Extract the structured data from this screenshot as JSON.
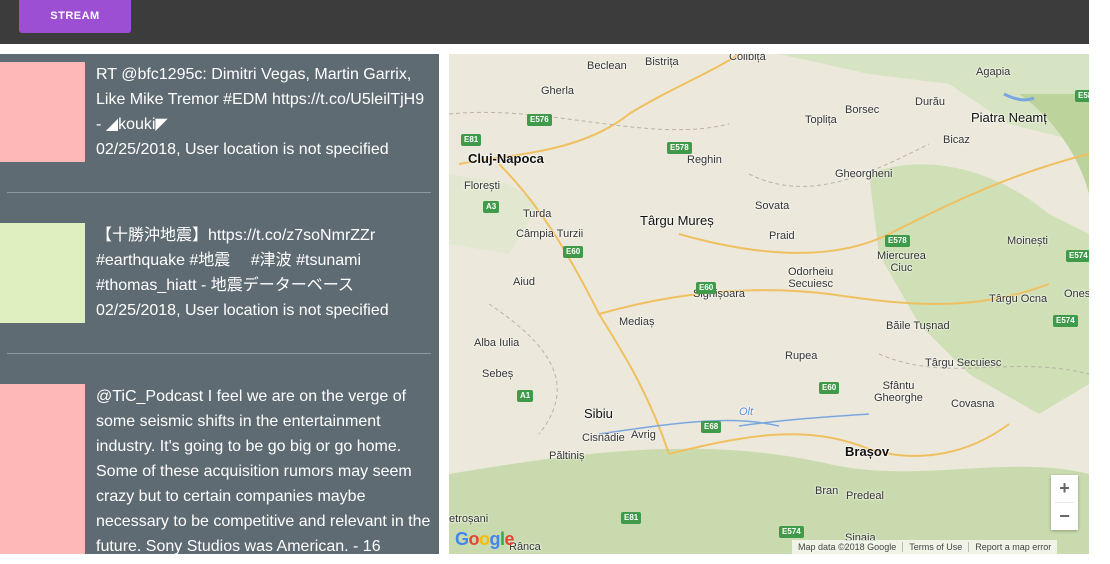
{
  "toolbar": {
    "stream_label": "STREAM"
  },
  "tweets": [
    {
      "color": "#ffb8b8",
      "text": "RT @bfc1295c: Dimitri Vegas, Martin Garrix, Like Mike Tremor #EDM https://t.co/U5leilTjH9 - ◢kouki◤",
      "meta": "02/25/2018, User location is not specified"
    },
    {
      "color": "#dff0c0",
      "text": "【十勝沖地震】https://t.co/z7soNmrZZr #earthquake #地震　 #津波 #tsunami #thomas_hiatt - 地震データーベース",
      "meta": "02/25/2018, User location is not specified"
    },
    {
      "color": "#ffb8b8",
      "text": "@TiC_Podcast I feel we are on the verge of some seismic shifts in the entertainment industry. It's going to be go big or go home. Some of these acquisition rumors may seem crazy but to certain companies maybe necessary to be competitive and relevant in the future. Sony Studios was American. - 16",
      "meta": ""
    }
  ],
  "map": {
    "cities": {
      "cluj": "Cluj-Napoca",
      "targu_mures": "Târgu Mureș",
      "brasov": "Brașov",
      "sibiu": "Sibiu",
      "alba_iulia": "Alba Iulia",
      "medias": "Mediaș",
      "sighisoara": "Sighișoara",
      "piatra_neamt": "Piatra Neamț",
      "beclean": "Beclean",
      "bistrita": "Bistrița",
      "gherla": "Gherla",
      "reghin": "Reghin",
      "toplita": "Toplița",
      "borsec": "Borsec",
      "bicaz": "Bicaz",
      "gheorgheni": "Gheorgheni",
      "floresti": "Florești",
      "turda": "Turda",
      "campia_turzii": "Câmpia Turzii",
      "sovata": "Sovata",
      "praid": "Praid",
      "miercurea_ciuc": "Miercurea\nCiuc",
      "moinesti": "Moinești",
      "aiud": "Aiud",
      "odorheiu": "Odorheiu\nSecuiesc",
      "targu_ocna": "Târgu Ocna",
      "onesti": "Ones",
      "baile_tusnad": "Băile Tușnad",
      "targu_secuiesc": "Târgu Secuiesc",
      "rupea": "Rupea",
      "sebes": "Sebeș",
      "sfantu": "Sfântu\nGheorghe",
      "covasna": "Covasna",
      "cisnadie": "Cisnădie",
      "avrig": "Avrig",
      "paltinis": "Păltiniș",
      "bran": "Bran",
      "predeal": "Predeal",
      "sinaia": "Sinaia",
      "petrosani": "etroșani",
      "ranca": "Rânca",
      "agapia": "Agapia",
      "duru": "Durău",
      "colibita": "Colibița",
      "olt": "Olt"
    },
    "roads": [
      "E81",
      "E576",
      "E578",
      "E60",
      "A3",
      "E60",
      "E60",
      "E578",
      "E574",
      "E574",
      "A1",
      "E68",
      "E60",
      "E81",
      "E574",
      "E58",
      "E81"
    ],
    "attribution": {
      "data": "Map data ©2018 Google",
      "terms": "Terms of Use",
      "report": "Report a map error"
    },
    "zoom_in": "+",
    "zoom_out": "−",
    "logo": {
      "g1": "G",
      "g2": "o",
      "g3": "o",
      "g4": "g",
      "g5": "l",
      "g6": "e"
    }
  }
}
